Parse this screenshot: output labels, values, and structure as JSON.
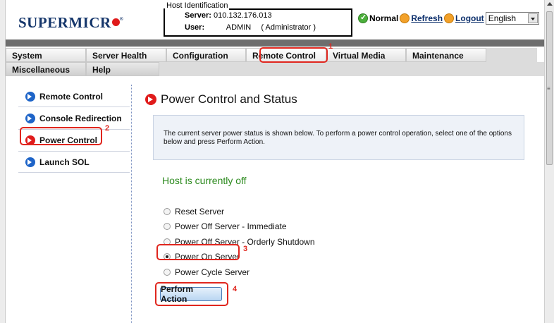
{
  "header": {
    "logo_text": "SUPERMICR",
    "logo_reg": "®",
    "host_legend": "Host Identification",
    "server_label": "Server:",
    "server_value": "010.132.176.013",
    "user_label": "User:",
    "user_value": "ADMIN",
    "user_role": "( Administrator )",
    "status_text": "Normal",
    "refresh_label": "Refresh",
    "logout_label": "Logout",
    "language": "English"
  },
  "nav": {
    "row1": [
      "System",
      "Server Health",
      "Configuration",
      "Remote Control",
      "Virtual Media",
      "Maintenance"
    ],
    "row2": [
      "Miscellaneous",
      "Help"
    ],
    "active": "Remote Control"
  },
  "sidebar": {
    "items": [
      {
        "label": "Remote Control",
        "icon": "blue-arrow-icon"
      },
      {
        "label": "Console Redirection",
        "icon": "blue-arrow-icon"
      },
      {
        "label": "Power Control",
        "icon": "red-arrow-icon"
      },
      {
        "label": "Launch SOL",
        "icon": "blue-arrow-icon"
      }
    ]
  },
  "annotations": [
    "1",
    "2",
    "3",
    "4"
  ],
  "main": {
    "title": "Power Control and Status",
    "info": "The current server power status is shown below. To perform a power control operation, select one of the options below and press Perform Action.",
    "host_status": "Host is currently off",
    "options": [
      {
        "label": "Reset Server",
        "checked": false
      },
      {
        "label": "Power Off Server - Immediate",
        "checked": false
      },
      {
        "label": "Power Off Server - Orderly Shutdown",
        "checked": false
      },
      {
        "label": "Power On Server",
        "checked": true
      },
      {
        "label": "Power Cycle Server",
        "checked": false
      }
    ],
    "perform_label": "Perform Action"
  }
}
